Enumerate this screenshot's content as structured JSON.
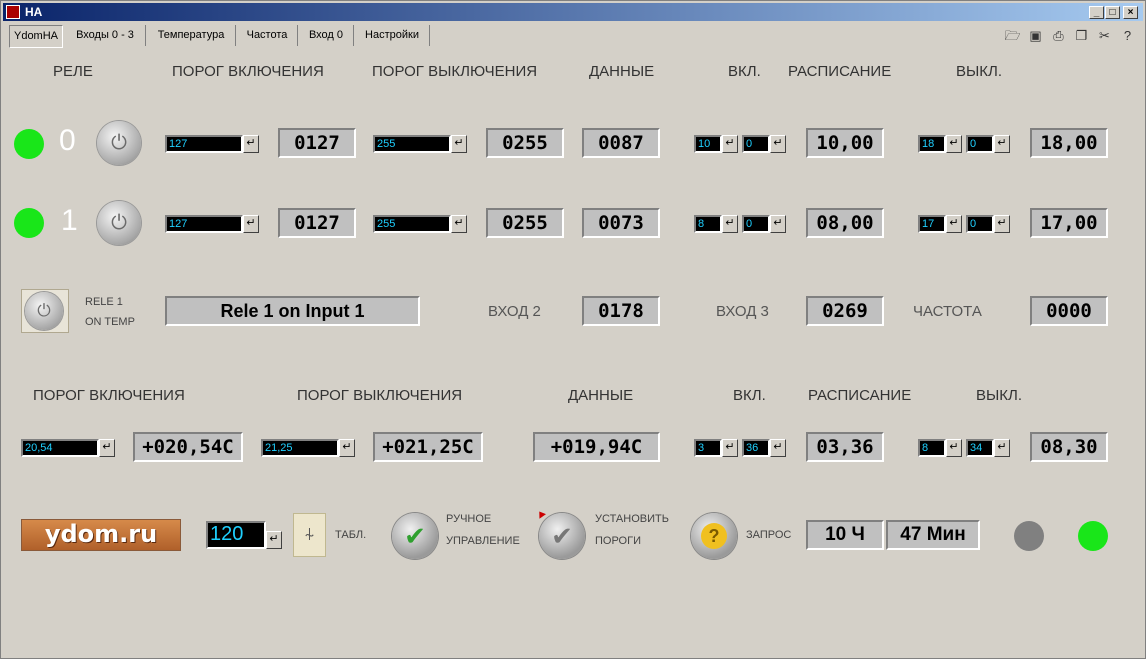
{
  "window": {
    "title": "HA"
  },
  "tabs": [
    "YdomHA",
    "Входы 0 - 3",
    "Температура",
    "Частота",
    "Вход 0",
    "Настройки"
  ],
  "headers": {
    "rele": "РЕЛЕ",
    "porog_on": "ПОРОГ ВКЛЮЧЕНИЯ",
    "porog_off": "ПОРОГ ВЫКЛЮЧЕНИЯ",
    "dannye": "ДАННЫЕ",
    "vkl": "ВКЛ.",
    "raspisanie": "РАСПИСАНИЕ",
    "vykl": "ВЫКЛ."
  },
  "relays": [
    {
      "num": "0",
      "led_color": "#19e619",
      "on_input": "127",
      "on_value": "0127",
      "off_input": "255",
      "off_value": "0255",
      "data": "0087",
      "on_h": "10",
      "on_m": "0",
      "on_time": "10,00",
      "off_h": "18",
      "off_m": "0",
      "off_time": "18,00"
    },
    {
      "num": "1",
      "led_color": "#19e619",
      "on_input": "127",
      "on_value": "0127",
      "off_input": "255",
      "off_value": "0255",
      "data": "0073",
      "on_h": "8",
      "on_m": "0",
      "on_time": "08,00",
      "off_h": "17",
      "off_m": "0",
      "off_time": "17,00"
    }
  ],
  "rele1": {
    "line1": "RELE 1",
    "line2": "ON TEMP",
    "status": "Rele 1 on Input 1"
  },
  "inputs": {
    "vhod2_label": "ВХОД 2",
    "vhod2": "0178",
    "vhod3_label": "ВХОД 3",
    "vhod3": "0269",
    "freq_label": "ЧАСТОТА",
    "freq": "0000"
  },
  "temp": {
    "h_porog_on": "ПОРОГ ВКЛЮЧЕНИЯ",
    "h_porog_off": "ПОРОГ ВЫКЛЮЧЕНИЯ",
    "h_dannye": "ДАННЫЕ",
    "h_vkl": "ВКЛ.",
    "h_raspisanie": "РАСПИСАНИЕ",
    "h_vykl": "ВЫКЛ.",
    "on_input": "20,54",
    "on_value": "+020,54C",
    "off_input": "21,25",
    "off_value": "+021,25C",
    "data": "+019,94C",
    "on_h": "3",
    "on_m": "36",
    "on_time": "03,36",
    "off_h": "8",
    "off_m": "34",
    "off_time": "08,30"
  },
  "bottom": {
    "logo": "ydom.ru",
    "interval": "120",
    "tabl": "ТАБЛ.",
    "manual_1": "РУЧНОЕ",
    "manual_2": "УПРАВЛЕНИЕ",
    "set_1": "УСТАНОВИТЬ",
    "set_2": "ПОРОГИ",
    "zapros": "ЗАПРОС",
    "hours": "10 Ч",
    "minutes": "47 Мин",
    "led_gray": "#808080",
    "led_green": "#19e619"
  },
  "icons": [
    "open-folder-icon",
    "save-icon",
    "print-icon",
    "copy-icon",
    "cut-icon",
    "help-icon"
  ]
}
